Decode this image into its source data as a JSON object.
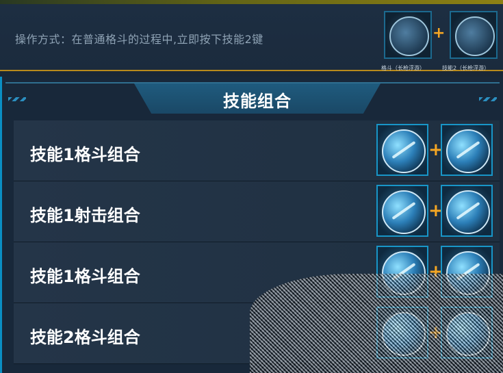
{
  "top": {
    "operation_text": "操作方式：在普通格斗的过程中,立即按下技能2键",
    "mini_skills": [
      {
        "icon": "sword-skill-icon",
        "caption": "格斗（长枪浮游）"
      },
      {
        "icon": "mech-skill-icon",
        "caption": "技能2（长枪浮游）"
      }
    ],
    "plus": "+"
  },
  "panel": {
    "title": "技能组合"
  },
  "rows": [
    {
      "label": "技能1格斗组合",
      "plus": "+"
    },
    {
      "label": "技能1射击组合",
      "plus": "+"
    },
    {
      "label": "技能1格斗组合",
      "plus": "+"
    },
    {
      "label": "技能2格斗组合",
      "plus": "+"
    }
  ],
  "colors": {
    "accent": "#1896c8",
    "plus": "#f5a623",
    "border_gold": "#b88a1c"
  }
}
